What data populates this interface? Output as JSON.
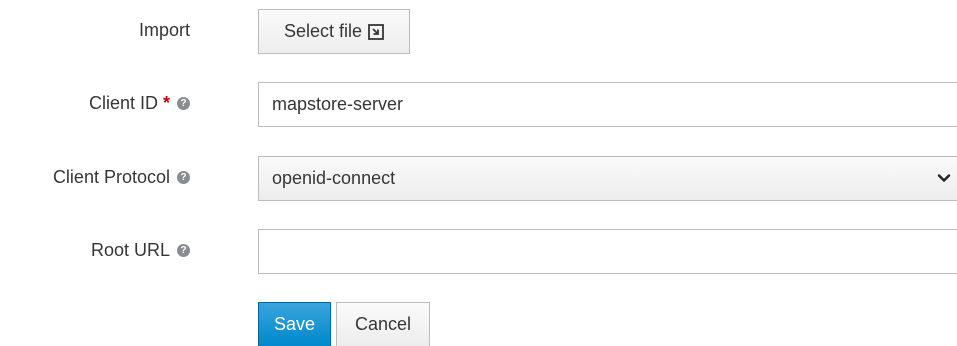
{
  "form": {
    "import": {
      "label": "Import",
      "button_label": "Select file",
      "button_icon": "file-import-icon"
    },
    "client_id": {
      "label": "Client ID",
      "required_marker": "*",
      "value": "mapstore-server",
      "help_icon": "question-circle-icon"
    },
    "client_protocol": {
      "label": "Client Protocol",
      "selected": "openid-connect",
      "help_icon": "question-circle-icon"
    },
    "root_url": {
      "label": "Root URL",
      "value": "",
      "help_icon": "question-circle-icon"
    },
    "actions": {
      "save_label": "Save",
      "cancel_label": "Cancel"
    }
  },
  "colors": {
    "primary": "#0088ce",
    "required": "#c00000",
    "text": "#363636",
    "border": "#bbbbbb"
  }
}
